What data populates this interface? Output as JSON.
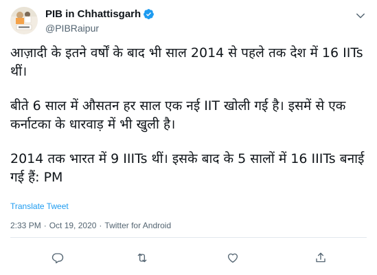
{
  "account": {
    "display_name": "PIB in Chhattisgarh",
    "handle": "@PIBRaipur",
    "verified": true,
    "avatar_caption": "सेवा भाव से"
  },
  "tweet": {
    "paragraphs": [
      "आज़ादी के इतने वर्षों के बाद भी साल 2014 से पहले तक देश में 16 IITs थीं।",
      "बीते 6 साल में औसतन हर साल एक नई IIT खोली गई है। इसमें से एक कर्नाटका के धारवाड़ में भी खुली है।",
      "2014 तक भारत में 9 IIITs थीं। इसके बाद के 5 सालों में 16 IIITs बनाई गई हैं: PM"
    ],
    "translate_label": "Translate Tweet",
    "time": "2:33 PM",
    "date": "Oct 19, 2020",
    "source": "Twitter for Android",
    "separator": "·"
  },
  "colors": {
    "accent": "#1d9bf0",
    "text": "#0f1419",
    "muted": "#536471",
    "divider": "#e1e8ed"
  },
  "icons": {
    "more": "chevron-down-icon",
    "reply": "reply-icon",
    "retweet": "retweet-icon",
    "like": "heart-icon",
    "share": "share-icon",
    "verified": "verified-badge-icon"
  }
}
